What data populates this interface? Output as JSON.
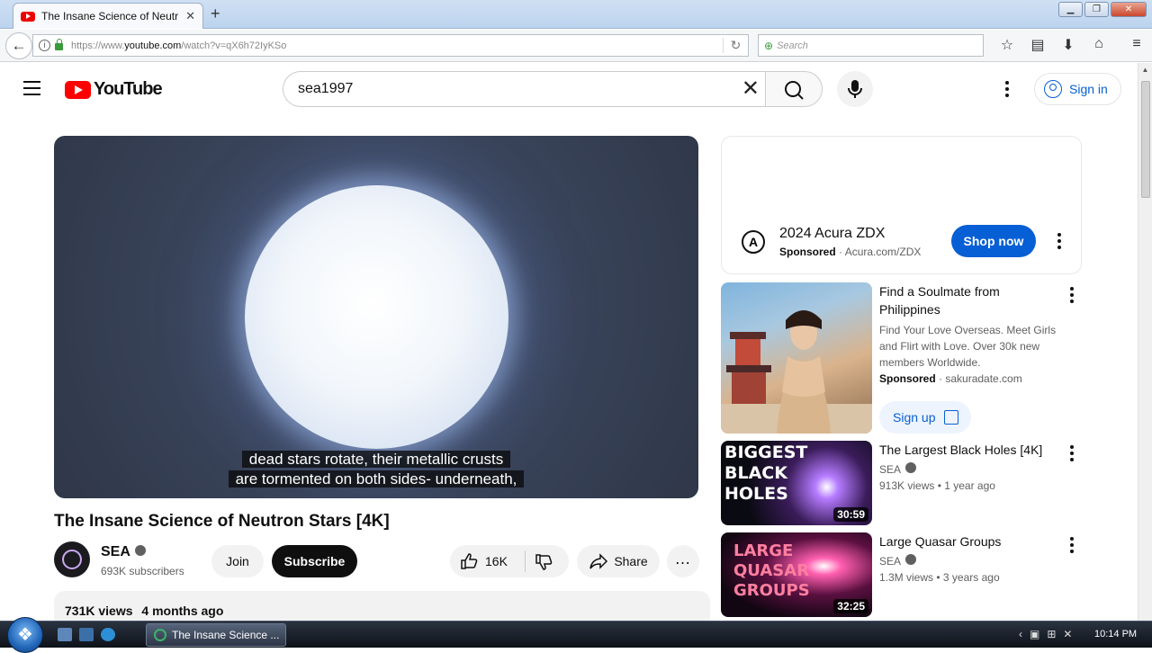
{
  "browser": {
    "tab_title": "The Insane Science of Neutr",
    "tab_close": "✕",
    "new_tab": "+",
    "url_prefix": "https://www.",
    "url_domain": "youtube.com",
    "url_path": "/watch?v=qX6h72IyKSo",
    "search_placeholder": "Search",
    "win_minimize": "▁",
    "win_restore": "❐",
    "win_close": "✕"
  },
  "youtube": {
    "logo_text": "YouTube",
    "search_value": "sea1997",
    "search_clear": "✕",
    "sign_in": "Sign in"
  },
  "video": {
    "caption_line1": "dead stars rotate, their metallic crusts",
    "caption_line2": "are tormented on both sides- underneath,",
    "title": "The Insane Science of Neutron Stars [4K]",
    "channel": "SEA",
    "subscribers": "693K subscribers",
    "join": "Join",
    "subscribe": "Subscribe",
    "likes": "16K",
    "share": "Share",
    "views": "731K views",
    "age": "4 months ago"
  },
  "ad": {
    "title": "2024 Acura ZDX",
    "sponsored": "Sponsored",
    "domain": "Acura.com/ZDX",
    "cta": "Shop now",
    "logo_letter": "Ⓐ"
  },
  "sidebar": {
    "items": [
      {
        "title": "Find a Soulmate from Philippines",
        "desc": "Find Your Love Overseas. Meet Girls and Flirt with Love. Over 30k new members Worldwide.",
        "sponsored": "Sponsored",
        "domain": "sakuradate.com",
        "cta": "Sign up"
      },
      {
        "title": "The Largest Black Holes [4K]",
        "channel": "SEA",
        "views": "913K views",
        "age": "1 year ago",
        "duration": "30:59",
        "thumb_text": "BIGGEST BLACK HOLES"
      },
      {
        "title": "Large Quasar Groups",
        "channel": "SEA",
        "views": "1.3M views",
        "age": "3 years ago",
        "duration": "32:25",
        "thumb_text": "LARGE QUASAR GROUPS"
      }
    ]
  },
  "taskbar": {
    "item_label": "The Insane Science ...",
    "clock": "10:14 PM"
  }
}
